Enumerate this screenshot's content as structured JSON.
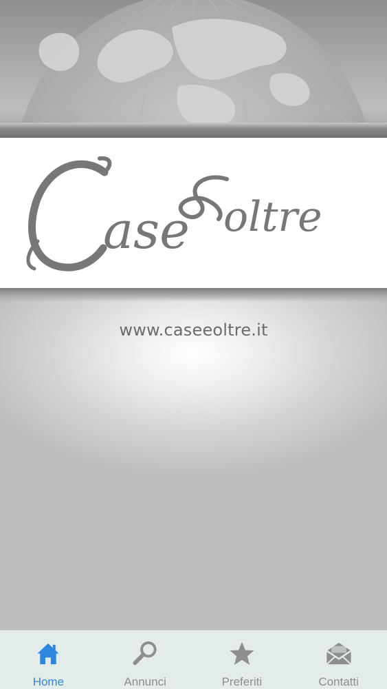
{
  "brand": {
    "logo_text": "Case & oltre",
    "website": "www.caseeoltre.it"
  },
  "tabbar": {
    "active_color": "#2f86e0",
    "inactive_color": "#8e8e8e",
    "tabs": [
      {
        "label": "Home",
        "icon": "house-icon",
        "active": true
      },
      {
        "label": "Annunci",
        "icon": "magnifier-icon",
        "active": false
      },
      {
        "label": "Preferiti",
        "icon": "star-icon",
        "active": false
      },
      {
        "label": "Contatti",
        "icon": "envelope-icon",
        "active": false
      }
    ]
  }
}
